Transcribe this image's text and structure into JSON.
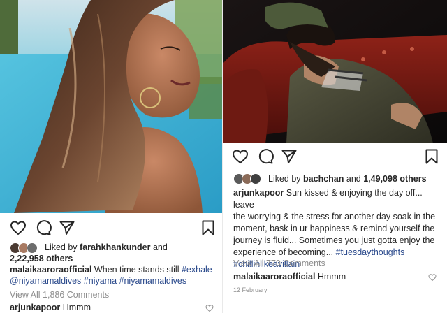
{
  "posts": [
    {
      "liked_prefix": "Liked by",
      "liked_user": "farahkhankunder",
      "liked_and": "and",
      "liked_count": "2,22,958 others",
      "caption": {
        "username": "malaikaaroraofficial",
        "text": "When time stands still",
        "tags": [
          "#exhale",
          "@niyamamaldives",
          "#niyama",
          "#niyamamaldives"
        ]
      },
      "view_all": "View All 1,886 Comments",
      "comment": {
        "username": "arjunkapoor",
        "text": "Hmmm"
      }
    },
    {
      "liked_prefix": "Liked by",
      "liked_user": "bachchan",
      "liked_and": "and",
      "liked_count": "1,49,098 others",
      "caption": {
        "username": "arjunkapoor",
        "lines": [
          "Sun kissed & enjoying the day off... leave",
          "the worrying & the stress for another day soak in the",
          "moment, bask in ur happiness & remind yourself the",
          "journey is fluid... Sometimes you just gotta enjoy the",
          "experience of becoming..."
        ],
        "tags": [
          "#tuesdaythoughts",
          "#chillinlikeavillain"
        ]
      },
      "view_all": "View All 770 Comments",
      "comment": {
        "username": "malaikaaroraofficial",
        "text": "Hmmm"
      },
      "date": "12 February"
    }
  ],
  "icons": [
    "heart-icon",
    "comment-icon",
    "share-icon",
    "bookmark-icon"
  ],
  "colors": {
    "hashtag": "#2b4a8c",
    "muted": "#8e8e8e",
    "text": "#262626"
  }
}
